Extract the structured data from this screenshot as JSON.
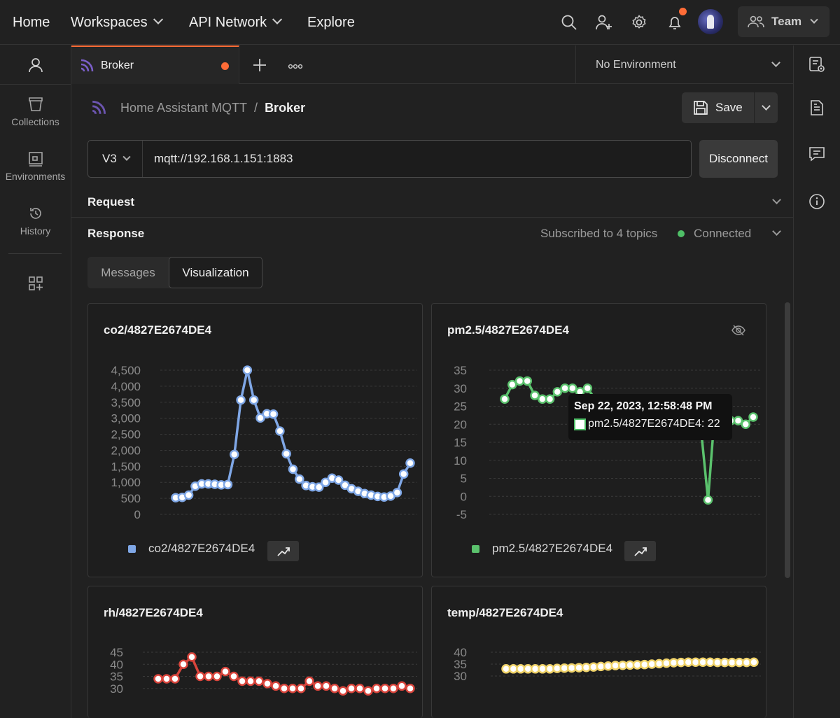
{
  "nav": {
    "home": "Home",
    "workspaces": "Workspaces",
    "api_network": "API Network",
    "explore": "Explore",
    "team": "Team"
  },
  "sidebar": {
    "items": [
      {
        "label": "Collections",
        "icon": "trash-can-icon"
      },
      {
        "label": "Environments",
        "icon": "environment-icon"
      },
      {
        "label": "History",
        "icon": "history-icon"
      }
    ]
  },
  "tabs": {
    "active": {
      "label": "Broker",
      "icon": "mqtt-icon"
    },
    "environment": "No Environment"
  },
  "breadcrumb": {
    "collection": "Home Assistant MQTT",
    "separator": "/",
    "current": "Broker"
  },
  "toolbar": {
    "save_label": "Save"
  },
  "request": {
    "version": "V3",
    "url": "mqtt://192.168.1.151:1883",
    "disconnect_label": "Disconnect"
  },
  "sections": {
    "request": "Request",
    "response": "Response",
    "subscribed": "Subscribed to 4 topics",
    "status": "Connected"
  },
  "view_tabs": {
    "messages": "Messages",
    "visualization": "Visualization"
  },
  "colors": {
    "accent": "#ff6c37",
    "connected": "#4fbf67"
  },
  "tooltip": {
    "title": "Sep 22, 2023, 12:58:48 PM",
    "row": "pm2.5/4827E2674DE4: 22"
  },
  "chart_data": [
    {
      "type": "line",
      "title": "co2/4827E2674DE4",
      "legend": "co2/4827E2674DE4",
      "color": "#7fa7e6",
      "yticks": [
        "4,500",
        "4,000",
        "3,500",
        "3,000",
        "2,500",
        "2,000",
        "1,500",
        "1,000",
        "500",
        "0"
      ],
      "ylim": [
        0,
        4500
      ],
      "series": [
        {
          "name": "co2/4827E2674DE4",
          "values": [
            520,
            530,
            600,
            880,
            950,
            950,
            940,
            920,
            930,
            1870,
            3570,
            4500,
            3570,
            3010,
            3140,
            3130,
            2600,
            1890,
            1410,
            1100,
            900,
            860,
            850,
            1000,
            1130,
            1070,
            910,
            800,
            720,
            650,
            600,
            560,
            540,
            570,
            680,
            1260,
            1600
          ]
        }
      ]
    },
    {
      "type": "line",
      "title": "pm2.5/4827E2674DE4",
      "legend": "pm2.5/4827E2674DE4",
      "color": "#5bc26d",
      "yticks": [
        "35",
        "30",
        "25",
        "20",
        "15",
        "10",
        "5",
        "0",
        "-5"
      ],
      "ylim": [
        -5,
        35
      ],
      "series": [
        {
          "name": "pm2.5/4827E2674DE4",
          "values": [
            27,
            31,
            32,
            32,
            28,
            27,
            27,
            29,
            30,
            30,
            29,
            30,
            27,
            25,
            21,
            21,
            21,
            21,
            20,
            20,
            21,
            21,
            21,
            21,
            21,
            20,
            20,
            -1,
            26,
            22,
            21,
            21,
            20,
            22
          ]
        }
      ]
    },
    {
      "type": "line",
      "title": "rh/4827E2674DE4",
      "color": "#d9453c",
      "yticks": [
        "45",
        "40",
        "35",
        "30"
      ],
      "ylim": [
        25,
        45
      ],
      "series": [
        {
          "name": "rh/4827E2674DE4",
          "values": [
            34,
            34,
            34,
            40,
            43,
            35,
            35,
            35,
            37,
            35,
            33,
            33,
            33,
            32,
            31,
            30,
            30,
            30,
            33,
            31,
            31,
            30,
            29,
            30,
            30,
            29,
            30,
            30,
            30,
            31,
            30
          ]
        }
      ]
    },
    {
      "type": "line",
      "title": "temp/4827E2674DE4",
      "color": "#f0d36a",
      "yticks": [
        "40",
        "35",
        "30"
      ],
      "ylim": [
        25,
        40
      ],
      "series": [
        {
          "name": "temp/4827E2674DE4",
          "values": [
            33,
            33,
            33,
            33,
            33,
            33,
            33,
            33.2,
            33.3,
            33.4,
            33.5,
            33.6,
            33.8,
            34,
            34.2,
            34.4,
            34.5,
            34.6,
            34.7,
            34.8,
            35,
            35.2,
            35.4,
            35.6,
            35.7,
            35.8,
            35.8,
            35.8,
            35.8,
            35.7,
            35.7,
            35.7,
            35.7,
            35.7,
            35.8
          ]
        }
      ]
    }
  ]
}
